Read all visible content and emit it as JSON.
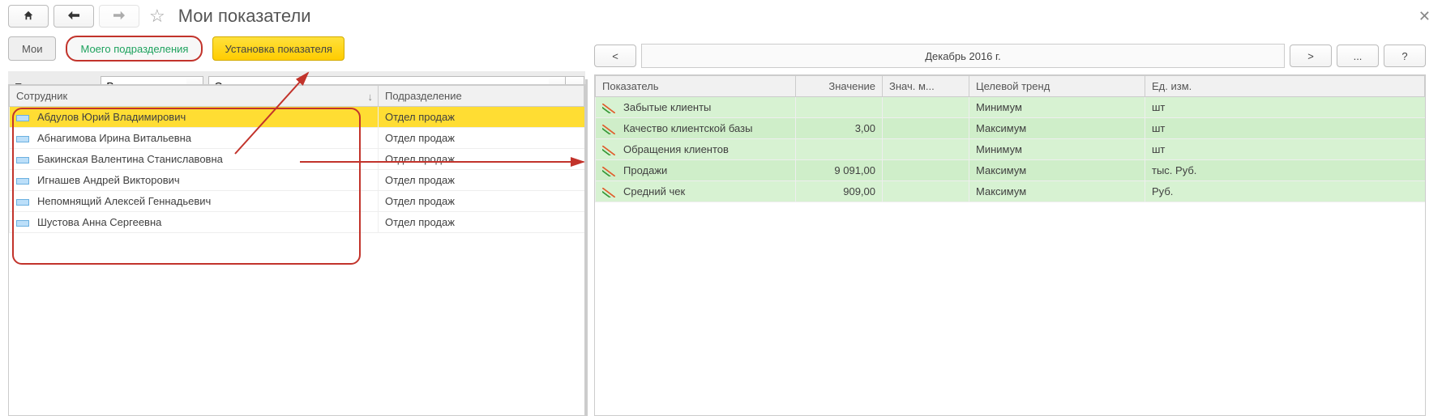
{
  "title": "Мои показатели",
  "toolbar": {
    "tab_mine": "Мои",
    "tab_dept": "Моего подразделения",
    "btn_set": "Установка показателя"
  },
  "filter": {
    "label": "Подразделение:",
    "op": "Равно",
    "value": "Отдел продаж"
  },
  "period": {
    "prev": "<",
    "label": "Декабрь 2016 г.",
    "next": ">",
    "more": "...",
    "help": "?"
  },
  "left_table": {
    "cols": [
      "Сотрудник",
      "Подразделение"
    ],
    "rows": [
      {
        "name": "Абдулов Юрий Владимирович",
        "dept": "Отдел продаж",
        "selected": true
      },
      {
        "name": "Абнагимова Ирина Витальевна",
        "dept": "Отдел продаж"
      },
      {
        "name": "Бакинская Валентина Станиславовна",
        "dept": "Отдел продаж"
      },
      {
        "name": "Игнашев Андрей Викторович",
        "dept": "Отдел продаж"
      },
      {
        "name": "Непомнящий Алексей Геннадьевич",
        "dept": "Отдел продаж"
      },
      {
        "name": "Шустова Анна Сергеевна",
        "dept": "Отдел продаж"
      }
    ]
  },
  "right_table": {
    "cols": [
      "Показатель",
      "Значение",
      "Знач. м...",
      "Целевой тренд",
      "Ед. изм."
    ],
    "rows": [
      {
        "name": "Забытые клиенты",
        "val": "",
        "valm": "",
        "trend": "Минимум",
        "unit": "шт"
      },
      {
        "name": "Качество клиентской базы",
        "val": "3,00",
        "valm": "",
        "trend": "Максимум",
        "unit": "шт"
      },
      {
        "name": "Обращения клиентов",
        "val": "",
        "valm": "",
        "trend": "Минимум",
        "unit": "шт"
      },
      {
        "name": "Продажи",
        "val": "9 091,00",
        "valm": "",
        "trend": "Максимум",
        "unit": "тыс. Руб."
      },
      {
        "name": "Средний чек",
        "val": "909,00",
        "valm": "",
        "trend": "Максимум",
        "unit": "Руб."
      }
    ]
  }
}
